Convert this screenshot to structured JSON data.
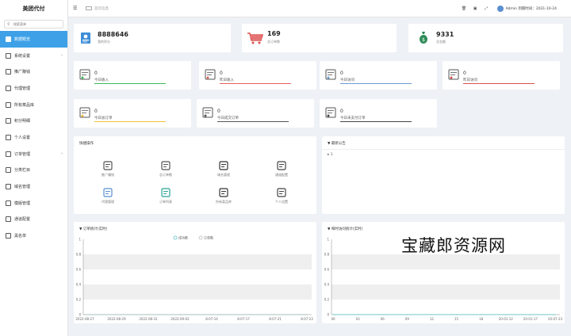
{
  "brand": "美团代付",
  "search": {
    "placeholder": "搜索菜单"
  },
  "sidebar": {
    "items": [
      {
        "label": "数据概览",
        "active": true,
        "has_arrow": false
      },
      {
        "label": "系统设置",
        "active": false,
        "has_arrow": true
      },
      {
        "label": "推广赚钱",
        "active": false,
        "has_arrow": false
      },
      {
        "label": "代理管理",
        "active": false,
        "has_arrow": false
      },
      {
        "label": "所有菜品库",
        "active": false,
        "has_arrow": false
      },
      {
        "label": "积分明细",
        "active": false,
        "has_arrow": false
      },
      {
        "label": "个人设置",
        "active": false,
        "has_arrow": false
      },
      {
        "label": "订单管理",
        "active": false,
        "has_arrow": true
      },
      {
        "label": "分类栏目",
        "active": false,
        "has_arrow": false
      },
      {
        "label": "域名管理",
        "active": false,
        "has_arrow": false
      },
      {
        "label": "模版管理",
        "active": false,
        "has_arrow": false
      },
      {
        "label": "通道配置",
        "active": false,
        "has_arrow": false
      },
      {
        "label": "黑名单",
        "active": false,
        "has_arrow": false
      }
    ]
  },
  "topbar": {
    "home_tab": "首页信息",
    "admin_info": "Admin 到期时间：2031-10-24"
  },
  "stats_top": [
    {
      "value": "8888646",
      "label": "我的积分"
    },
    {
      "value": "169",
      "label": "总订单数"
    },
    {
      "value": "9331",
      "label": "总金额"
    }
  ],
  "stats_small": [
    {
      "value": "0",
      "label": "今日收入",
      "bar_color": "#3cba5a"
    },
    {
      "value": "0",
      "label": "昨日收入",
      "bar_color": "#e0655a"
    },
    {
      "value": "0",
      "label": "今日访问",
      "bar_color": "#6b9bd9"
    },
    {
      "value": "0",
      "label": "昨日访问",
      "bar_color": "#d9534f"
    },
    {
      "value": "0",
      "label": "今日总订单",
      "bar_color": "#f2c037"
    },
    {
      "value": "0",
      "label": "今日成交订单",
      "bar_color": "#555555"
    },
    {
      "value": "0",
      "label": "今日未支付订单",
      "bar_color": "#444444"
    }
  ],
  "quick_ops": {
    "title": "快捷操作",
    "items": [
      {
        "label": "推广赚钱",
        "icon": "money-bag-icon"
      },
      {
        "label": "总订单数",
        "icon": "order-list-icon"
      },
      {
        "label": "域名管理",
        "icon": "domain-icon"
      },
      {
        "label": "通道配置",
        "icon": "channel-icon"
      },
      {
        "label": "代理管理",
        "icon": "agent-icon"
      },
      {
        "label": "订单列表",
        "icon": "cart-icon"
      },
      {
        "label": "所有菜品库",
        "icon": "dishes-icon"
      },
      {
        "label": "个人设置",
        "icon": "settings-icon"
      }
    ]
  },
  "notice": {
    "title": "最新公告",
    "item": "1"
  },
  "watermark": "宝藏郎资源网",
  "chart_data": [
    {
      "type": "line",
      "title": "订单统计(实时)",
      "series": [
        {
          "name": "成功数",
          "values": [
            0,
            0,
            0,
            0,
            0,
            0,
            0,
            0
          ]
        },
        {
          "name": "订单数",
          "values": [
            0,
            0,
            0,
            0,
            0,
            0,
            0,
            0
          ]
        }
      ],
      "categories": [
        "2022-08-27",
        "2022-08-29",
        "2022-08-31",
        "2022-09-02",
        "8-07-14",
        "8-07-17",
        "8-07-21",
        "8-07-23"
      ],
      "ylim": [
        0,
        1
      ],
      "yticks": [
        "1",
        "0.8",
        "0.6",
        "0.4",
        "0.2",
        "0"
      ],
      "legend_position": "top-center",
      "grid": true
    },
    {
      "type": "line",
      "title": "每时访问统计(实时)",
      "series": [
        {
          "values": [
            0,
            0,
            0,
            0,
            0,
            0,
            0,
            0,
            0,
            0
          ]
        }
      ],
      "categories": [
        "00",
        "03",
        "06",
        "09",
        "12",
        "15",
        "18",
        "20-01-12",
        "20-01-17",
        "20-07-23"
      ],
      "ylim": [
        0,
        1
      ],
      "yticks": [
        "1",
        "0.8",
        "0.6",
        "0.4",
        "0.2",
        "0"
      ],
      "grid": true
    }
  ]
}
